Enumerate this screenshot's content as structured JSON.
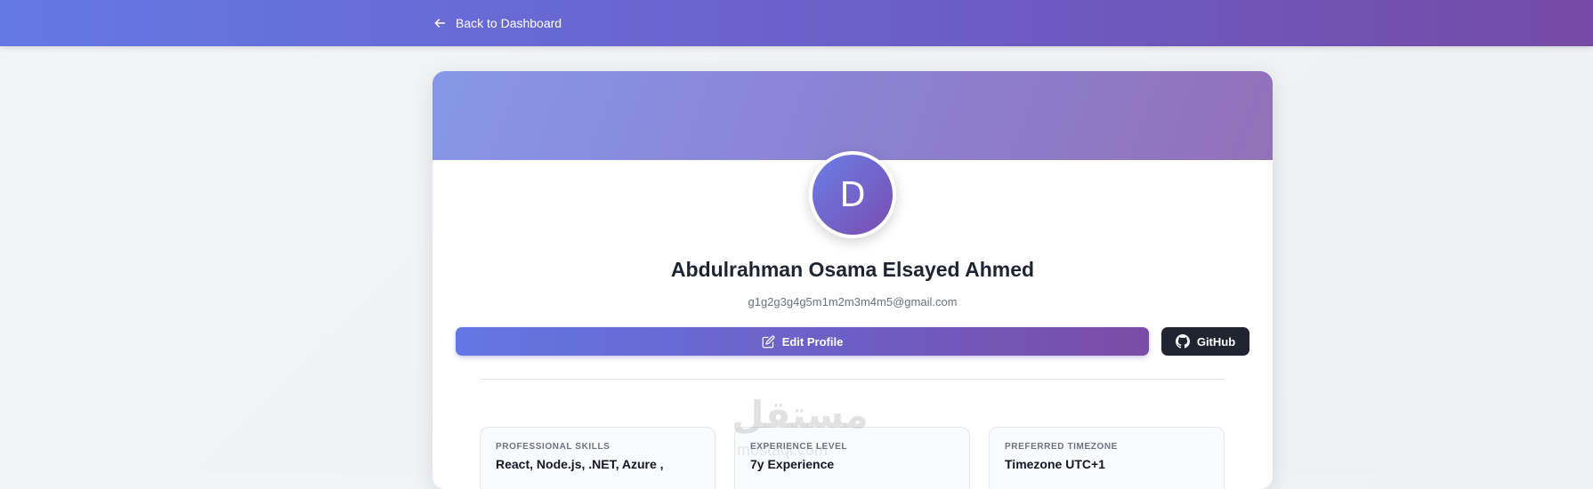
{
  "header": {
    "back_label": "Back to Dashboard",
    "back_icon": "arrow-left-icon",
    "gradient_start": "#6478e4",
    "gradient_end": "#744ba6"
  },
  "profile": {
    "avatar_initial": "D",
    "name": "Abdulrahman Osama Elsayed Ahmed",
    "email": "g1g2g3g4g5m1m2m3m4m5@gmail.com"
  },
  "actions": {
    "edit_label": "Edit Profile",
    "edit_icon": "edit-icon",
    "github_label": "GitHub",
    "github_icon": "github-icon"
  },
  "info_cards": [
    {
      "label": "PROFESSIONAL SKILLS",
      "value": "React, Node.js, .NET, Azure ,"
    },
    {
      "label": "EXPERIENCE LEVEL",
      "value": "7y Experience"
    },
    {
      "label": "PREFERRED TIMEZONE",
      "value": "Timezone UTC+1"
    }
  ],
  "watermark": {
    "text": "مستقل",
    "sub": "mostaql.com"
  },
  "colors": {
    "accent": "#6d5fc6",
    "dark_button": "#1f2430"
  }
}
